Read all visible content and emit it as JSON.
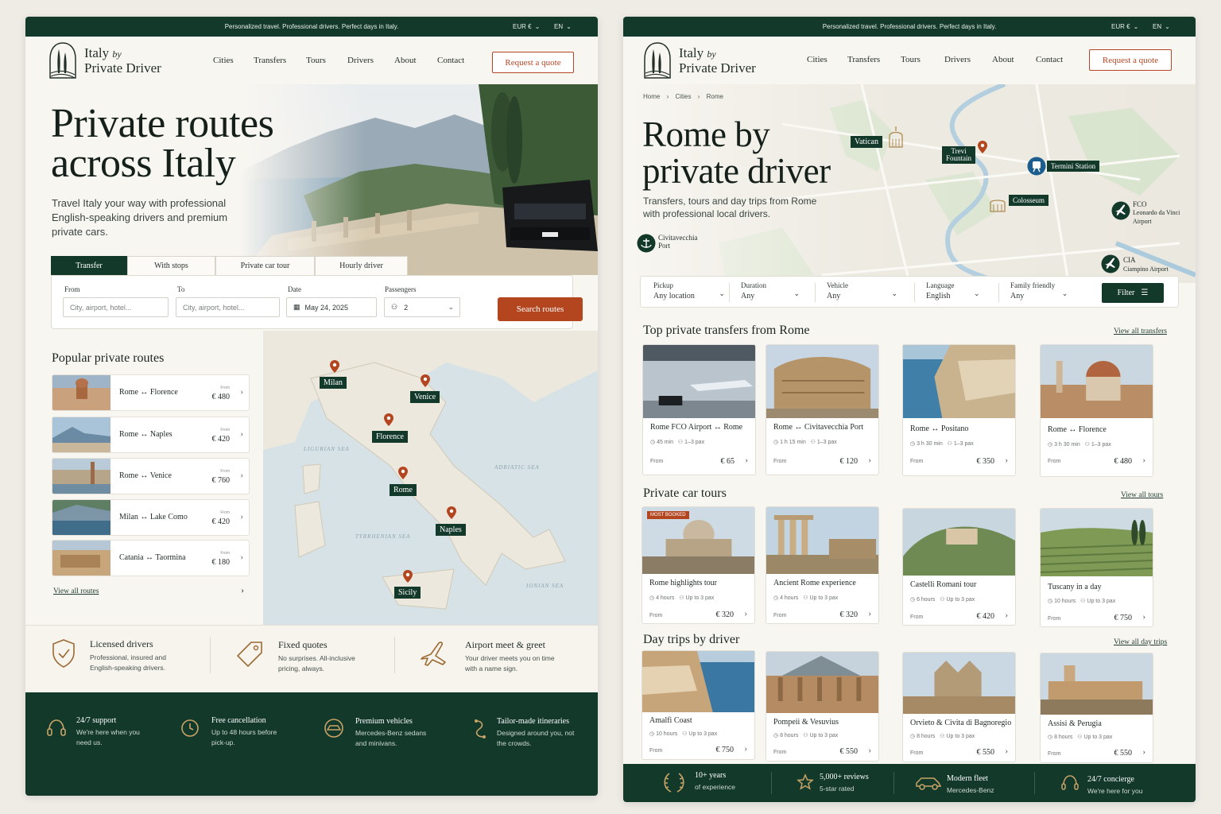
{
  "brand": {
    "name_line1": "Italy",
    "name_by": "by",
    "name_line2": "Private Driver"
  },
  "topbar": {
    "tagline": "Personalized travel. Professional drivers. Perfect days in Italy.",
    "currency": "EUR €",
    "language": "EN"
  },
  "nav": {
    "items": [
      "Cities",
      "Transfers",
      "Tours",
      "Drivers",
      "About",
      "Contact"
    ],
    "quote_button": "Request a quote"
  },
  "colors": {
    "dark_green": "#13392b",
    "accent": "#b4461f",
    "background": "#f8f6f1"
  },
  "home": {
    "hero_title_1": "Private routes",
    "hero_title_2": "across Italy",
    "hero_sub": "Travel Italy your way with professional English-speaking drivers and premium private cars.",
    "tabs": [
      "Transfer",
      "With stops",
      "Private car tour",
      "Hourly driver"
    ],
    "search": {
      "from_label": "From",
      "from_placeholder": "City, airport, hotel...",
      "to_label": "To",
      "to_placeholder": "City, airport, hotel...",
      "date_label": "Date",
      "date_value": "May 24, 2025",
      "passengers_label": "Passengers",
      "passengers_value": "2",
      "button": "Search routes"
    },
    "popular_title": "Popular private routes",
    "routes": [
      {
        "name": "Rome ↔ Florence",
        "from": "From",
        "price": "€ 480"
      },
      {
        "name": "Rome ↔ Naples",
        "from": "From",
        "price": "€ 420"
      },
      {
        "name": "Rome ↔ Venice",
        "from": "From",
        "price": "€ 760"
      },
      {
        "name": "Milan ↔ Lake Como",
        "from": "From",
        "price": "€ 420"
      },
      {
        "name": "Catania ↔ Taormina",
        "from": "From",
        "price": "€ 180"
      }
    ],
    "view_all_routes": "View all routes",
    "map_cities": [
      "Milan",
      "Venice",
      "Florence",
      "Rome",
      "Naples",
      "Sicily"
    ],
    "seas": [
      "LIGURIAN SEA",
      "ADRIATIC SEA",
      "TYRRHENIAN SEA",
      "IONIAN SEA"
    ],
    "features": [
      {
        "title": "Licensed drivers",
        "sub": "Professional, insured and English-speaking drivers.",
        "icon": "shield-check-icon"
      },
      {
        "title": "Fixed quotes",
        "sub": "No surprises. All-inclusive pricing, always.",
        "icon": "price-tag-icon"
      },
      {
        "title": "Airport meet & greet",
        "sub": "Your driver meets you on time with a name sign.",
        "icon": "airplane-icon"
      }
    ],
    "footer": [
      {
        "title": "24/7 support",
        "sub": "We're here when you need us.",
        "icon": "headset-icon"
      },
      {
        "title": "Free cancellation",
        "sub": "Up to 48 hours before pick-up.",
        "icon": "clock-icon"
      },
      {
        "title": "Premium vehicles",
        "sub": "Mercedes-Benz sedans and minivans.",
        "icon": "car-icon"
      },
      {
        "title": "Tailor-made itineraries",
        "sub": "Designed around you, not the crowds.",
        "icon": "route-icon"
      }
    ]
  },
  "rome": {
    "breadcrumb": [
      "Home",
      "Cities",
      "Rome"
    ],
    "title_1": "Rome by",
    "title_2": "private driver",
    "sub": "Transfers, tours and day trips from Rome with professional local drivers.",
    "map_labels": {
      "vatican": "Vatican",
      "trevi_1": "Trevi",
      "trevi_2": "Fountain",
      "termini": "Termini Station",
      "colosseum": "Colosseum",
      "fco": "FCO",
      "fco_sub_1": "Leonardo da Vinci",
      "fco_sub_2": "Airport",
      "cia": "CIA",
      "cia_sub": "Ciampino Airport",
      "civita_1": "Civitavecchia",
      "civita_2": "Port"
    },
    "filters": [
      {
        "label": "Pickup",
        "value": "Any location"
      },
      {
        "label": "Duration",
        "value": "Any"
      },
      {
        "label": "Vehicle",
        "value": "Any"
      },
      {
        "label": "Language",
        "value": "English"
      },
      {
        "label": "Family friendly",
        "value": "Any"
      }
    ],
    "filter_button": "Filter",
    "transfers_title": "Top private transfers from Rome",
    "transfers_link": "View all transfers",
    "transfers": [
      {
        "title": "Rome FCO Airport ↔ Rome",
        "duration": "45 min",
        "pax": "1–3 pax",
        "from": "From",
        "price": "€ 65"
      },
      {
        "title": "Rome ↔ Civitavecchia Port",
        "duration": "1 h 15 min",
        "pax": "1–3 pax",
        "from": "From",
        "price": "€ 120"
      },
      {
        "title": "Rome ↔ Positano",
        "duration": "3 h 30 min",
        "pax": "1–3 pax",
        "from": "From",
        "price": "€ 350"
      },
      {
        "title": "Rome ↔ Florence",
        "duration": "3 h 30 min",
        "pax": "1–3 pax",
        "from": "From",
        "price": "€ 480"
      }
    ],
    "tours_title": "Private car tours",
    "tours_link": "View all tours",
    "most_booked": "MOST BOOKED",
    "tours": [
      {
        "title": "Rome highlights tour",
        "duration": "4 hours",
        "pax": "Up to 3 pax",
        "from": "From",
        "price": "€ 320"
      },
      {
        "title": "Ancient Rome experience",
        "duration": "4 hours",
        "pax": "Up to 3 pax",
        "from": "From",
        "price": "€ 320"
      },
      {
        "title": "Castelli Romani tour",
        "duration": "6 hours",
        "pax": "Up to 3 pax",
        "from": "From",
        "price": "€ 420"
      },
      {
        "title": "Tuscany in a day",
        "duration": "10 hours",
        "pax": "Up to 3 pax",
        "from": "From",
        "price": "€ 750"
      }
    ],
    "trips_title": "Day trips by driver",
    "trips_link": "View all day trips",
    "trips": [
      {
        "title": "Amalfi Coast",
        "duration": "10 hours",
        "pax": "Up to 3 pax",
        "from": "From",
        "price": "€ 750"
      },
      {
        "title": "Pompeii & Vesuvius",
        "duration": "8 hours",
        "pax": "Up to 3 pax",
        "from": "From",
        "price": "€ 550"
      },
      {
        "title": "Orvieto & Civita di Bagnoregio",
        "duration": "8 hours",
        "pax": "Up to 3 pax",
        "from": "From",
        "price": "€ 550"
      },
      {
        "title": "Assisi & Perugia",
        "duration": "8 hours",
        "pax": "Up to 3 pax",
        "from": "From",
        "price": "€ 550"
      }
    ],
    "footer": [
      {
        "title": "10+ years",
        "sub": "of experience",
        "icon": "laurel-icon"
      },
      {
        "title": "5,000+ reviews",
        "sub": "5-star rated",
        "icon": "star-icon"
      },
      {
        "title": "Modern fleet",
        "sub": "Mercedes-Benz",
        "icon": "car-icon"
      },
      {
        "title": "24/7 concierge",
        "sub": "We're here for you",
        "icon": "headset-icon"
      }
    ]
  }
}
